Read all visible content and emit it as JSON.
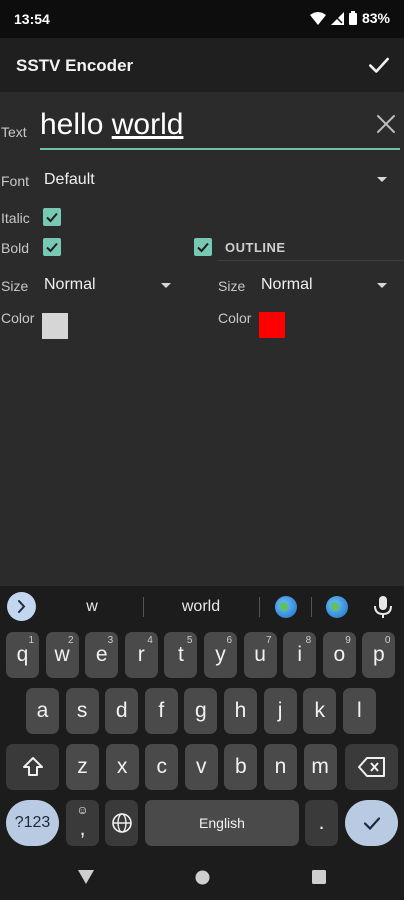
{
  "status_bar": {
    "time": "13:54",
    "battery": "83%",
    "icons": [
      "wifi-icon",
      "signal-icon",
      "battery-icon"
    ]
  },
  "app_bar": {
    "title": "SSTV Encoder",
    "action_icon": "check-icon"
  },
  "form": {
    "text_label": "Text",
    "text_value_word1": "hello",
    "text_value_word2": "world",
    "font_label": "Font",
    "font_value": "Default",
    "italic_label": "Italic",
    "italic_checked": true,
    "bold_label": "Bold",
    "bold_checked": true,
    "outline_label": "OUTLINE",
    "outline_checked": true,
    "size_label": "Size",
    "size_value": "Normal",
    "color_label": "Color",
    "color_value": "#d6d6d6",
    "outline_size_label": "Size",
    "outline_size_value": "Normal",
    "outline_color_label": "Color",
    "outline_color_value": "#ff0000"
  },
  "keyboard": {
    "suggestions": [
      "w",
      "world"
    ],
    "row1": [
      {
        "k": "q",
        "h": "1"
      },
      {
        "k": "w",
        "h": "2"
      },
      {
        "k": "e",
        "h": "3"
      },
      {
        "k": "r",
        "h": "4"
      },
      {
        "k": "t",
        "h": "5"
      },
      {
        "k": "y",
        "h": "6"
      },
      {
        "k": "u",
        "h": "7"
      },
      {
        "k": "i",
        "h": "8"
      },
      {
        "k": "o",
        "h": "9"
      },
      {
        "k": "p",
        "h": "0"
      }
    ],
    "row2": [
      "a",
      "s",
      "d",
      "f",
      "g",
      "h",
      "j",
      "k",
      "l"
    ],
    "row3": [
      "z",
      "x",
      "c",
      "v",
      "b",
      "n",
      "m"
    ],
    "symbols_key": "?123",
    "emoji_comma_key": ",",
    "space_label": "English",
    "period_key": "."
  }
}
